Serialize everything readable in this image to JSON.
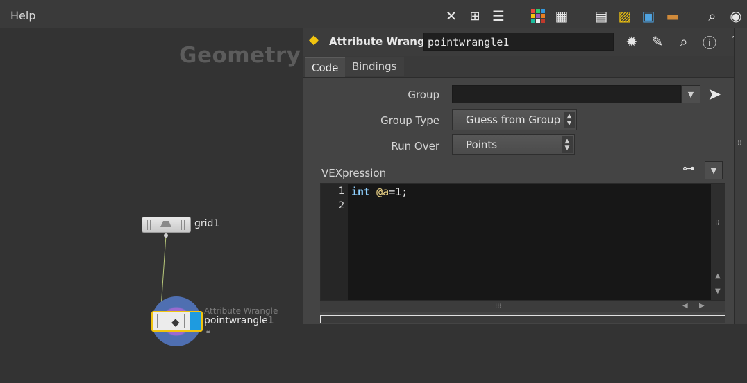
{
  "menubar": {
    "help_label": "Help"
  },
  "toolbar_icons": [
    "tools-icon",
    "tree-icon",
    "list-icon",
    "palette-icon",
    "grid-layout-icon",
    "panel-icon",
    "note-icon",
    "image-add-icon",
    "package-icon",
    "search-icon",
    "eye-icon"
  ],
  "network": {
    "context_title": "Geometry",
    "nodes": [
      {
        "name": "grid1"
      },
      {
        "type_label": "Attribute Wrangle",
        "name": "pointwrangle1"
      }
    ]
  },
  "params": {
    "node_type": "Attribute Wrangle",
    "node_name": "pointwrangle1",
    "tabs": [
      {
        "label": "Code",
        "active": true
      },
      {
        "label": "Bindings",
        "active": false
      }
    ],
    "group": {
      "label": "Group",
      "value": ""
    },
    "group_type": {
      "label": "Group Type",
      "value": "Guess from Group"
    },
    "run_over": {
      "label": "Run Over",
      "value": "Points"
    },
    "vex": {
      "label": "VEXpression",
      "line_numbers": [
        "1",
        "2"
      ],
      "code_keyword": "int",
      "code_attr": "@a",
      "code_rest": "=1;"
    }
  },
  "colors": {
    "selection": "#f1c40f",
    "wrangle_accent": "#1e9be0",
    "background": "#333333"
  }
}
